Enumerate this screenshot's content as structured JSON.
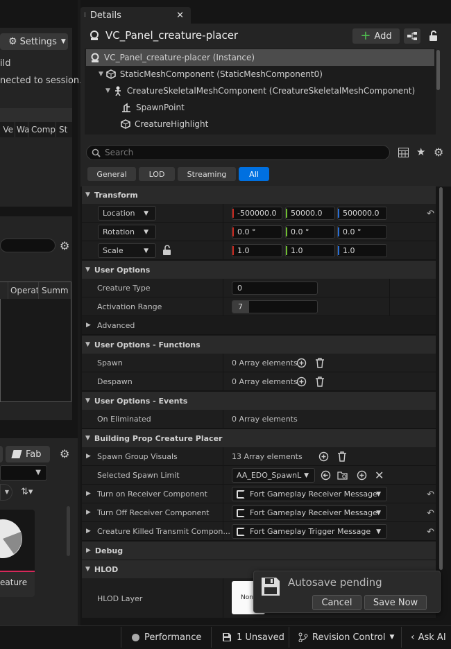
{
  "left_panel": {
    "settings_label": "Settings",
    "status_line1": "ild",
    "status_line2": "nected to session.",
    "table1_columns": [
      "Ve",
      "Wa",
      "Comp",
      "St"
    ],
    "table2_columns": [
      "Operat",
      "Summ"
    ],
    "fab_label": "Fab",
    "asset_label": "eature"
  },
  "details": {
    "tab_title": "Details",
    "actor_name": "VC_Panel_creature-placer",
    "add_label": "Add",
    "tree": [
      {
        "label": "VC_Panel_creature-placer (Instance)",
        "icon": "actor-icon"
      },
      {
        "label": "StaticMeshComponent (StaticMeshComponent0)",
        "icon": "static-mesh-icon"
      },
      {
        "label": "CreatureSkeletalMeshComponent (CreatureSkeletalMeshComponent)",
        "icon": "skeletal-mesh-icon"
      },
      {
        "label": "SpawnPoint",
        "icon": "spawn-point-icon"
      },
      {
        "label": "CreatureHighlight",
        "icon": "static-mesh-icon"
      }
    ],
    "search_placeholder": "Search",
    "filters": [
      "General",
      "LOD",
      "Streaming",
      "All"
    ],
    "active_filter": "All",
    "transform": {
      "category": "Transform",
      "location_label": "Location",
      "rotation_label": "Rotation",
      "scale_label": "Scale",
      "location": [
        "-500000.0",
        "50000.0",
        "500000.0"
      ],
      "rotation": [
        "0.0 °",
        "0.0 °",
        "0.0 °"
      ],
      "scale": [
        "1.0",
        "1.0",
        "1.0"
      ]
    },
    "user_options": {
      "category": "User Options",
      "creature_type_label": "Creature Type",
      "creature_type_value": "0",
      "activation_range_label": "Activation Range",
      "activation_range_value": "7",
      "activation_range_fill": 0.2,
      "advanced_label": "Advanced"
    },
    "functions": {
      "category": "User Options - Functions",
      "spawn_label": "Spawn",
      "spawn_value": "0 Array elements",
      "despawn_label": "Despawn",
      "despawn_value": "0 Array elements"
    },
    "events": {
      "category": "User Options - Events",
      "on_eliminated_label": "On Eliminated",
      "on_eliminated_value": "0 Array elements"
    },
    "placer": {
      "category": "Building Prop Creature Placer",
      "spawn_group_label": "Spawn Group Visuals",
      "spawn_group_value": "13 Array elements",
      "selected_limit_label": "Selected Spawn Limit",
      "selected_limit_value": "AA_EDO_SpawnL",
      "turn_on_label": "Turn on Receiver Component",
      "turn_on_value": "Fort Gameplay Receiver Message",
      "turn_off_label": "Turn Off Receiver Component",
      "turn_off_value": "Fort Gameplay Receiver Message",
      "killed_label": "Creature Killed Transmit Compon...",
      "killed_value": "Fort Gameplay Trigger Message C"
    },
    "debug": {
      "category": "Debug"
    },
    "hlod": {
      "category": "HLOD",
      "layer_label": "HLOD Layer",
      "layer_value": "Non"
    }
  },
  "autosave": {
    "title": "Autosave pending",
    "cancel_label": "Cancel",
    "save_label": "Save Now"
  },
  "status_bar": {
    "performance": "Performance",
    "unsaved": "1 Unsaved",
    "revision_control": "Revision Control",
    "ask_ai": "Ask AI"
  },
  "colors": {
    "accent": "#0070e0",
    "axis_x": "#c8281e",
    "axis_y": "#6fbf2f",
    "axis_z": "#2a6fd6",
    "add_green": "#4fc04f"
  }
}
